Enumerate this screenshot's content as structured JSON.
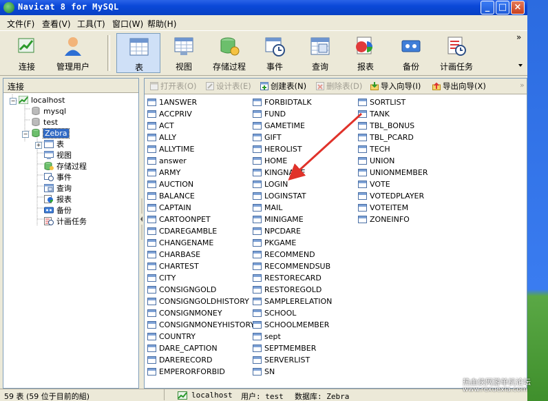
{
  "window": {
    "title": "Navicat 8 for MySQL",
    "min_label": "_",
    "max_label": "□",
    "close_label": "×"
  },
  "menu": [
    "文件(F)",
    "查看(V)",
    "工具(T)",
    "窗口(W)",
    "帮助(H)"
  ],
  "toolbar": [
    "连接",
    "管理用户",
    "表",
    "视图",
    "存储过程",
    "事件",
    "查询",
    "报表",
    "备份",
    "计画任务"
  ],
  "toolbar_more": "»",
  "left": {
    "header": "连接",
    "tree": [
      "localhost",
      "mysql",
      "test",
      "Zebra",
      "表",
      "视图",
      "存储过程",
      "事件",
      "查询",
      "报表",
      "备份",
      "计画任务"
    ]
  },
  "objtoolbar": [
    "打开表(O)",
    "设计表(E)",
    "创建表(N)",
    "删除表(D)",
    "导入向导(I)",
    "导出向导(X)"
  ],
  "tables": {
    "col1": [
      "1ANSWER",
      "ACCPRIV",
      "ACT",
      "ALLY",
      "ALLYTIME",
      "answer",
      "ARMY",
      "AUCTION",
      "BALANCE",
      "CAPTAIN",
      "CARTOONPET",
      "CDAREGAMBLE",
      "CHANGENAME",
      "CHARBASE",
      "CHARTEST",
      "CITY",
      "CONSIGNGOLD",
      "CONSIGNGOLDHISTORY",
      "CONSIGNMONEY",
      "CONSIGNMONEYHISTORY",
      "COUNTRY",
      "DARE_CAPTION",
      "DARERECORD",
      "EMPERORFORBID"
    ],
    "col2": [
      "FORBIDTALK",
      "FUND",
      "GAMETIME",
      "GIFT",
      "HEROLIST",
      "HOME",
      "KINGNAME",
      "LOGIN",
      "LOGINSTAT",
      "MAIL",
      "MINIGAME",
      "NPCDARE",
      "PKGAME",
      "RECOMMEND",
      "RECOMMENDSUB",
      "RESTORECARD",
      "RESTOREGOLD",
      "SAMPLERELATION",
      "SCHOOL",
      "SCHOOLMEMBER",
      "sept",
      "SEPTMEMBER",
      "SERVERLIST",
      "SN"
    ],
    "col3": [
      "SORTLIST",
      "TANK",
      "TBL_BONUS",
      "TBL_PCARD",
      "TECH",
      "UNION",
      "UNIONMEMBER",
      "VOTE",
      "VOTEDPLAYER",
      "VOTEITEM",
      "ZONEINFO"
    ]
  },
  "status": {
    "count": "59 表 (59 位于目前的組)",
    "conn": "localhost",
    "user": "用户: test",
    "db": "数据库: Zebra"
  },
  "watermark": {
    "line1": "热血侠网游单机论坛",
    "line2": "www.rexuexia.com"
  },
  "colors": {
    "title_blue": "#0a48d8",
    "arrow_red": "#e0322a",
    "selected_bg": "#316ac5"
  }
}
